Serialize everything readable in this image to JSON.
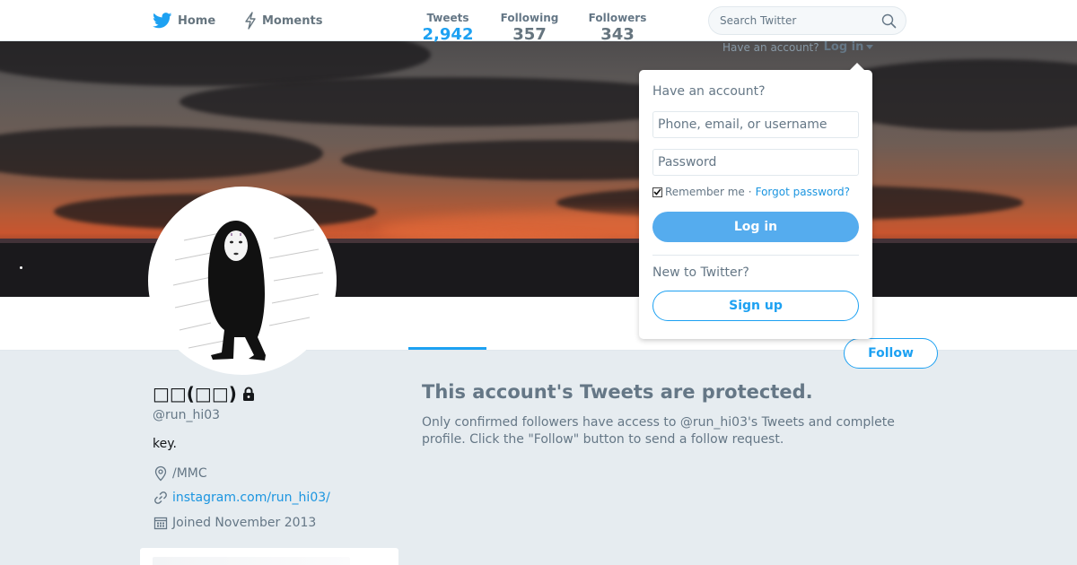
{
  "nav": {
    "home_label": "Home",
    "moments_label": "Moments",
    "search_placeholder": "Search Twitter"
  },
  "profile": {
    "display_name": "□□(□□)",
    "handle": "@run_hi03",
    "bio": "key.",
    "location": "/MMC",
    "website": "instagram.com/run_hi03/",
    "joined": "Joined November 2013",
    "protected": true
  },
  "stats": {
    "tweets_label": "Tweets",
    "tweets_value": "2,942",
    "following_label": "Following",
    "following_value": "357",
    "followers_label": "Followers",
    "followers_value": "343",
    "active_tab": "Tweets"
  },
  "actions": {
    "follow_label": "Follow"
  },
  "protected_notice": {
    "title": "This account's Tweets are protected.",
    "body": "Only confirmed followers have access to @run_hi03's Tweets and complete profile. Click the \"Follow\" button to send a follow request."
  },
  "login": {
    "prompt": "Have an account?",
    "link_label": "Log in",
    "heading": "Have an account?",
    "username_placeholder": "Phone, email, or username",
    "password_placeholder": "Password",
    "remember_label": "Remember me",
    "separator": "·",
    "forgot_label": "Forgot password?",
    "login_button": "Log in",
    "new_prompt": "New to Twitter?",
    "signup_button": "Sign up",
    "remember_checked": true
  },
  "colors": {
    "accent": "#1da1f2",
    "link": "#1b95e0",
    "login_button_bg": "#55acee",
    "page_bg": "#e6ecf0"
  },
  "icons": {
    "logo": "twitter-bird-icon",
    "moments": "lightning-icon",
    "search": "magnifier-icon",
    "lock": "lock-icon",
    "location": "map-pin-icon",
    "link": "link-icon",
    "calendar": "calendar-icon"
  }
}
